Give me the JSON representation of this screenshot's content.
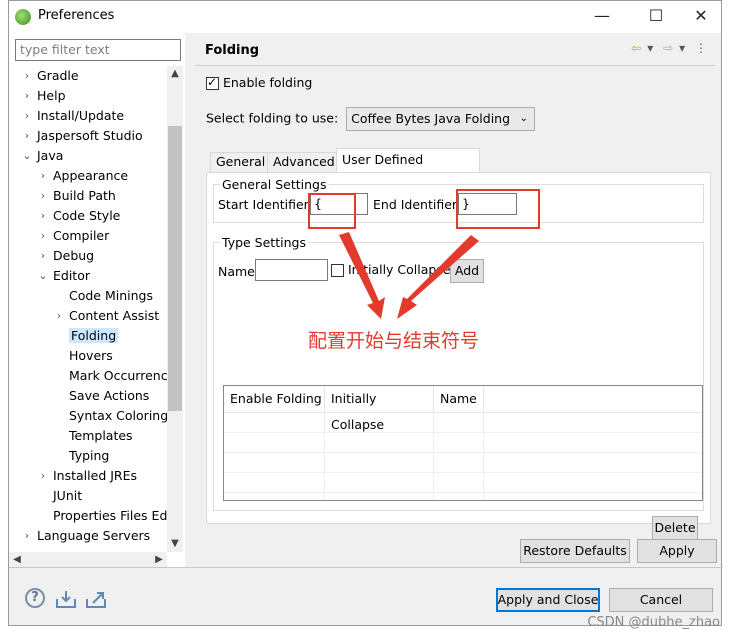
{
  "window": {
    "title": "Preferences",
    "minimize": "—",
    "maximize": "☐",
    "close": "✕"
  },
  "filter": {
    "placeholder": "type filter text"
  },
  "tree": [
    {
      "label": "Gradle",
      "twisty": "›"
    },
    {
      "label": "Help",
      "twisty": "›"
    },
    {
      "label": "Install/Update",
      "twisty": "›"
    },
    {
      "label": "Jaspersoft Studio",
      "twisty": "›"
    },
    {
      "label": "Java",
      "twisty": "⌄"
    },
    {
      "label": "Appearance",
      "twisty": "›"
    },
    {
      "label": "Build Path",
      "twisty": "›"
    },
    {
      "label": "Code Style",
      "twisty": "›"
    },
    {
      "label": "Compiler",
      "twisty": "›"
    },
    {
      "label": "Debug",
      "twisty": "›"
    },
    {
      "label": "Editor",
      "twisty": "⌄"
    },
    {
      "label": "Code Minings",
      "twisty": ""
    },
    {
      "label": "Content Assist",
      "twisty": "›"
    },
    {
      "label": "Folding",
      "twisty": ""
    },
    {
      "label": "Hovers",
      "twisty": ""
    },
    {
      "label": "Mark Occurrences",
      "twisty": ""
    },
    {
      "label": "Save Actions",
      "twisty": ""
    },
    {
      "label": "Syntax Coloring",
      "twisty": ""
    },
    {
      "label": "Templates",
      "twisty": ""
    },
    {
      "label": "Typing",
      "twisty": ""
    },
    {
      "label": "Installed JREs",
      "twisty": "›"
    },
    {
      "label": "JUnit",
      "twisty": ""
    },
    {
      "label": "Properties Files Editor",
      "twisty": ""
    },
    {
      "label": "Language Servers",
      "twisty": "›"
    }
  ],
  "page": {
    "title": "Folding",
    "enable_folding": "Enable folding",
    "enable_folding_checked": true,
    "select_label": "Select folding to use:",
    "select_value": "Coffee Bytes Java Folding",
    "tabs": [
      "General",
      "Advanced",
      "User Defined Regions"
    ],
    "general_settings": {
      "legend": "General Settings",
      "start_label": "Start Identifier:",
      "start_value": "{",
      "end_label": "End Identifier:",
      "end_value": "}"
    },
    "type_settings": {
      "legend": "Type Settings",
      "name_label": "Name",
      "name_value": "",
      "initially_collapse": "Initially Collapse",
      "add_button": "Add"
    },
    "table_headers": [
      "Enable Folding",
      "Initially Collapse",
      "Name"
    ],
    "delete_button": "Delete",
    "restore_defaults": "Restore Defaults",
    "apply": "Apply"
  },
  "annotation": "配置开始与结束符号",
  "footer": {
    "apply_close": "Apply and Close",
    "cancel": "Cancel"
  },
  "watermark": "CSDN @dubhe_zhao",
  "colors": {
    "annotation_red": "#e23b2e",
    "selection": "#cce8ff",
    "default_button_border": "#0078d7"
  }
}
